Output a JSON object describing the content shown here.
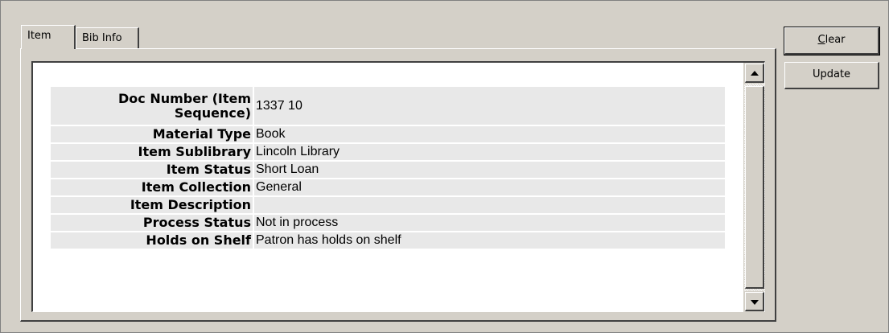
{
  "tabs": [
    {
      "label": "Item",
      "active": true
    },
    {
      "label": "Bib Info",
      "active": false
    }
  ],
  "fields": [
    {
      "label": "Doc Number (Item Sequence)",
      "label_line1": "Doc Number (Item",
      "label_line2": "Sequence)",
      "value": "1337 10"
    },
    {
      "label": "Material Type",
      "value": "Book"
    },
    {
      "label": "Item Sublibrary",
      "value": "Lincoln Library"
    },
    {
      "label": "Item Status",
      "value": "Short Loan"
    },
    {
      "label": "Item Collection",
      "value": "General"
    },
    {
      "label": "Item Description",
      "value": ""
    },
    {
      "label": "Process Status",
      "value": "Not in process"
    },
    {
      "label": "Holds on Shelf",
      "value": "Patron has holds on shelf"
    }
  ],
  "buttons": {
    "clear_mnemonic": "C",
    "clear_rest": "lear",
    "update_label": "Update"
  },
  "icons": {
    "scroll_up": "arrow-up-icon",
    "scroll_down": "arrow-down-icon"
  }
}
